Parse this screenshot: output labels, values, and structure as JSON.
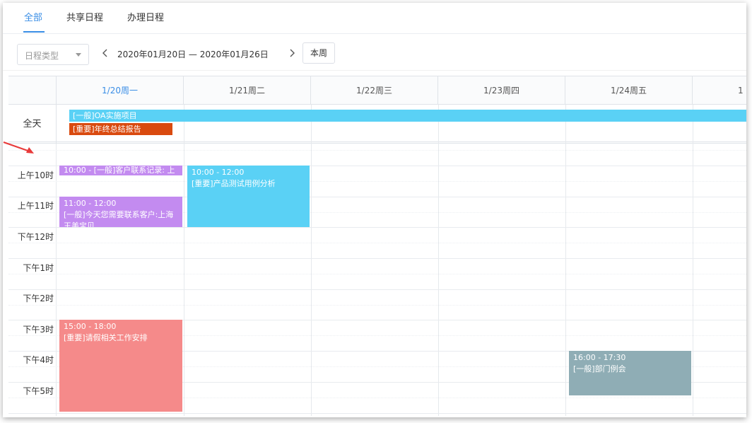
{
  "tabs": [
    {
      "label": "全部",
      "active": true
    },
    {
      "label": "共享日程",
      "active": false
    },
    {
      "label": "办理日程",
      "active": false
    }
  ],
  "toolbar": {
    "type_placeholder": "日程类型",
    "date_range": "2020年01月20日 — 2020年01月26日",
    "this_week_label": "本周"
  },
  "columns": [
    {
      "label": "1/20周一",
      "today": true
    },
    {
      "label": "1/21周二",
      "today": false
    },
    {
      "label": "1/22周三",
      "today": false
    },
    {
      "label": "1/23周四",
      "today": false
    },
    {
      "label": "1/24周五",
      "today": false
    },
    {
      "label": "1",
      "today": false
    }
  ],
  "allday_label": "全天",
  "allday_events": [
    {
      "title": "[一般]OA实施项目",
      "color": "#5ad1f5"
    },
    {
      "title": "[重要]年终总结报告",
      "color": "#d94a0f"
    }
  ],
  "time_labels": [
    "上午10时",
    "上午11时",
    "下午12时",
    "下午1时",
    "下午2时",
    "下午3时",
    "下午4时",
    "下午5时"
  ],
  "events": [
    {
      "time": "10:00 - [一般]客户联系记录: 上",
      "title": "",
      "color": "#c38bf0"
    },
    {
      "time": "11:00 - 12:00",
      "title": "[一般]今天您需要联系客户:上海王美宝贝",
      "color": "#c38bf0"
    },
    {
      "time": "10:00 - 12:00",
      "title": "[重要]产品测试用例分析",
      "color": "#5ad1f5"
    },
    {
      "time": "15:00 - 18:00",
      "title": "[重要]请假相关工作安排",
      "color": "#f58a8a"
    },
    {
      "time": "16:00 - 17:30",
      "title": "[一般]部门例会",
      "color": "#8fadb5"
    }
  ],
  "colors": {
    "accent": "#3a8ee6",
    "arrow": "#e83a3a"
  }
}
